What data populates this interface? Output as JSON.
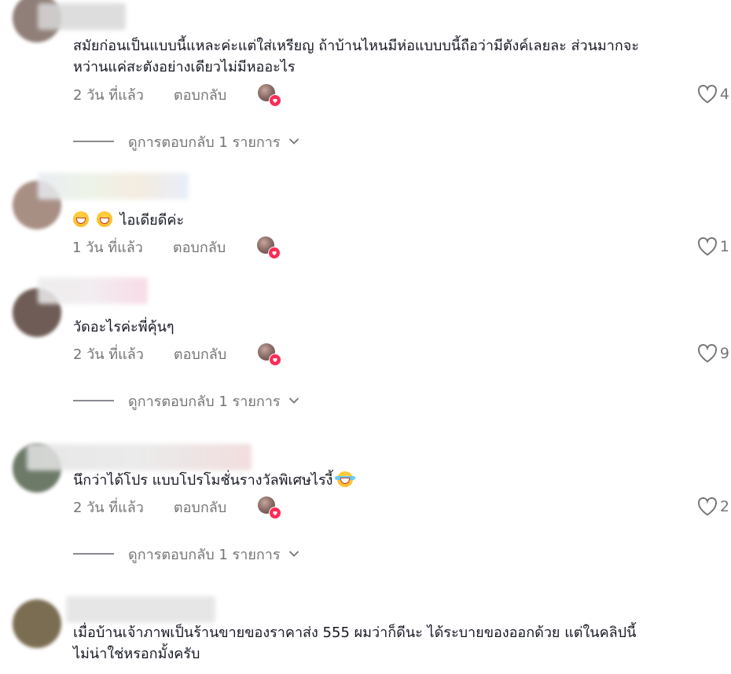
{
  "comments": [
    {
      "lines": [
        "สมัยก่อนเป็นแบบนี้แหละค่ะแต่ใส่เหรียญ ถ้าบ้านไหนมีห่อแบบบนี้ถือว่ามีตังค์เลยละ ส่วนมากจะ",
        "หว่านแค่สะตังอย่างเดียวไม่มีหออะไร"
      ],
      "time": "2 วัน ที่แล้ว",
      "reply": "ตอบกลับ",
      "likes": "4",
      "view_replies": "ดูการตอบกลับ 1 รายการ",
      "avatar_color": "#8f7f78",
      "name_blur_color": "#d8d8d8"
    },
    {
      "emojis": [
        "grinning-emoji",
        "grinning-emoji"
      ],
      "lines": [
        "ไอเดียดีค่ะ"
      ],
      "time": "1 วัน ที่แล้ว",
      "reply": "ตอบกลับ",
      "likes": "1",
      "avatar_color": "#a88f84",
      "name_blur_color": "#e6e9f2"
    },
    {
      "lines": [
        "วัดอะไรค่ะพี่คุ้นๆ"
      ],
      "time": "2 วัน ที่แล้ว",
      "reply": "ตอบกลับ",
      "likes": "9",
      "view_replies": "ดูการตอบกลับ 1 รายการ",
      "avatar_color": "#6f5c56",
      "name_blur_color": "#ece6ea"
    },
    {
      "lines": [
        "นึกว่าได้โปร แบบโปรโมชั่นรางวัลพิเศษไรงี้"
      ],
      "trailing_emoji": "laughing-tears-emoji",
      "time": "2 วัน ที่แล้ว",
      "reply": "ตอบกลับ",
      "likes": "2",
      "view_replies": "ดูการตอบกลับ 1 รายการ",
      "avatar_color": "#6d7a68",
      "name_blur_color": "#e4e4e4"
    },
    {
      "lines": [
        "เมื่อบ้านเจ้าภาพเป็นร้านขายของราคาส่ง 555 ผมว่าก็ดีนะ ได้ระบายของออกด้วย แต่ในคลิปนี้",
        "ไม่น่าใช่หรอกมั้งครับ"
      ],
      "avatar_color": "#7b6d52",
      "name_blur_color": "#e2e2e2"
    }
  ],
  "colors": {
    "text": "#161823",
    "meta": "#757575",
    "like_badge": "#fe2c55"
  }
}
